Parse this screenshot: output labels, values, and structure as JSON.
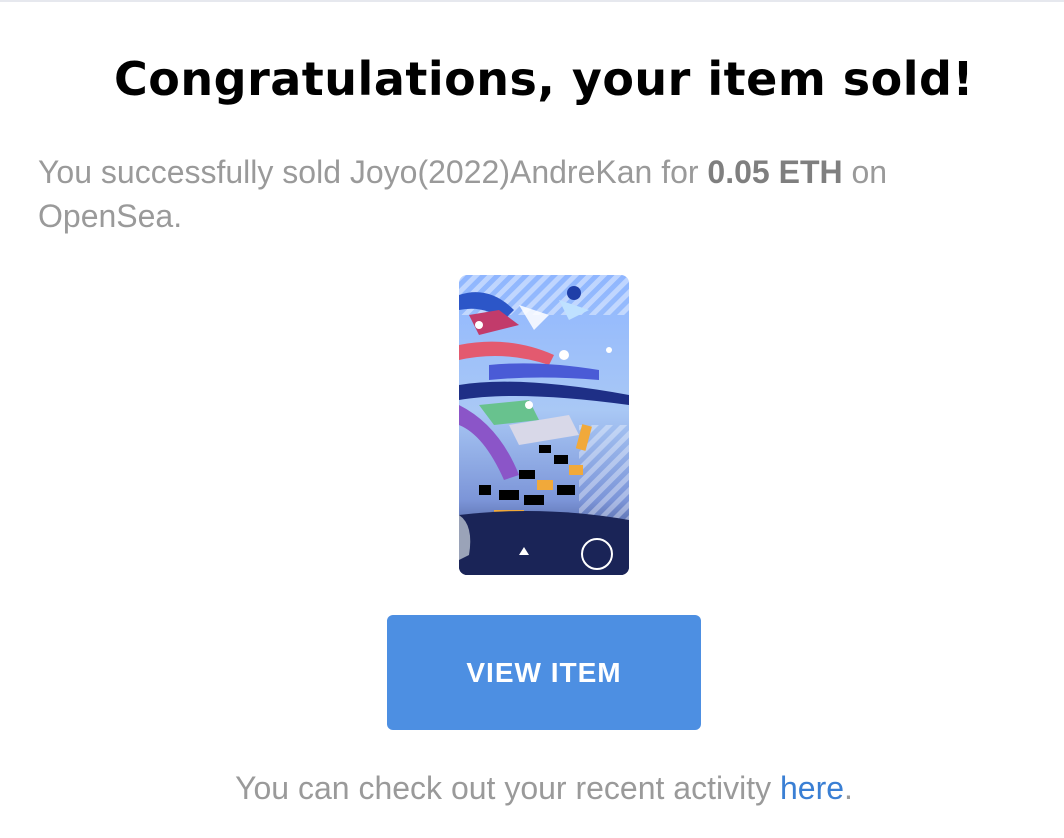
{
  "email": {
    "title": "Congratulations, your item sold!",
    "message": {
      "prefix": "You successfully sold Joyo(2022)AndreKan for ",
      "amount": "0.05 ETH",
      "suffix": " on OpenSea."
    },
    "item_image": {
      "icon": "nft-artwork-image"
    },
    "view_button_label": "VIEW ITEM",
    "footer": {
      "prefix": "You can check out your recent activity ",
      "link_label": "here",
      "suffix": "."
    }
  },
  "colors": {
    "button": "#4d8fe2",
    "link": "#3a7fd4",
    "muted_text": "#9a9a9a",
    "title_text": "#000000"
  }
}
